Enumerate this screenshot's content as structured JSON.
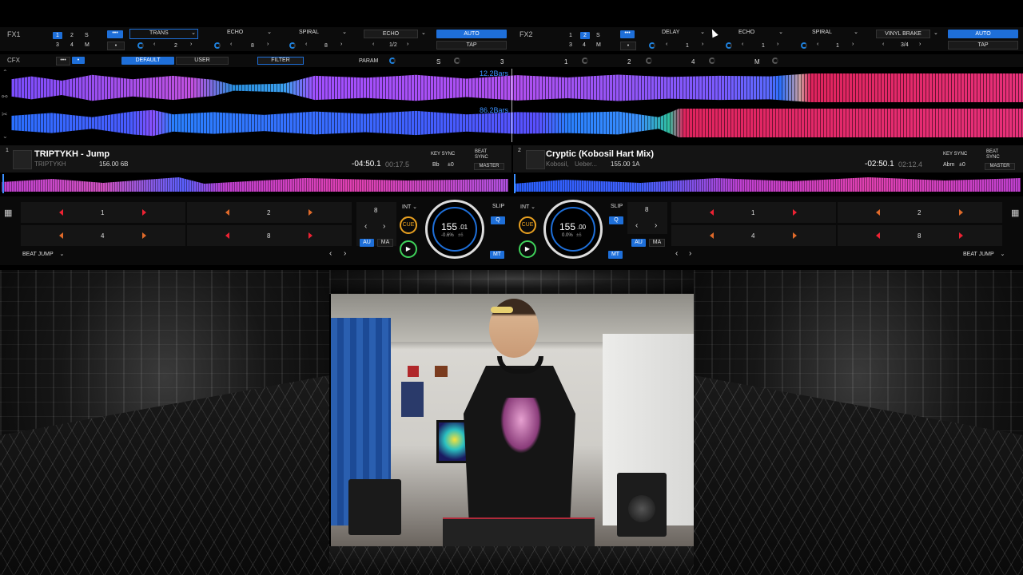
{
  "fx1": {
    "label": "FX1",
    "deck_grid": [
      "1",
      "2",
      "S",
      "3",
      "4",
      "M"
    ],
    "slots": [
      "TRANS",
      "ECHO",
      "SPIRAL"
    ],
    "slot_values": [
      "2",
      "8",
      "8"
    ],
    "effect": "ECHO",
    "effect_value": "1/2",
    "auto": "AUTO",
    "tap": "TAP"
  },
  "fx2": {
    "label": "FX2",
    "deck_grid": [
      "1",
      "2",
      "S",
      "3",
      "4",
      "M"
    ],
    "slots": [
      "DELAY",
      "ECHO",
      "SPIRAL"
    ],
    "slot_values": [
      "1",
      "1",
      "1"
    ],
    "effect": "VINYL BRAKE",
    "effect_value": "3/4",
    "auto": "AUTO",
    "tap": "TAP"
  },
  "cfx": {
    "label": "CFX",
    "default": "DEFAULT",
    "user": "USER",
    "filter": "FILTER",
    "param": "PARAM",
    "letters": [
      "S",
      "3",
      "1",
      "2",
      "4",
      "M"
    ]
  },
  "waveform": {
    "top_marker": "12.2Bars",
    "bottom_marker": "86.2Bars"
  },
  "deck1": {
    "num": "1",
    "title": "TRIPTYKH - Jump",
    "artist": "TRIPTYKH",
    "bpm_key": "156.00 6B",
    "remain": "-04:50.1",
    "elapsed": "00:17.5",
    "key_sync": "KEY SYNC",
    "key": "Bb",
    "key_offset": "±0",
    "beat_sync": "BEAT SYNC",
    "master": "MASTER",
    "pads": [
      "1",
      "2",
      "4",
      "8"
    ],
    "loop_size": "8",
    "int": "INT",
    "slip": "SLIP",
    "cue": "CUE",
    "q": "Q",
    "au": "AU",
    "ma": "MA",
    "mt": "MT",
    "bpm_main": "155",
    "bpm_dec": ".01",
    "pitch": "-0.6%",
    "pitch_range": "±6",
    "beat_jump": "BEAT JUMP"
  },
  "deck2": {
    "num": "2",
    "title": "Cryptic (Kobosil Hart Mix)",
    "artist": "Kobosil,",
    "artist2": "Ueber...",
    "bpm_key": "155.00 1A",
    "remain": "-02:50.1",
    "elapsed": "02:12.4",
    "key_sync": "KEY SYNC",
    "key": "Abm",
    "key_offset": "±0",
    "beat_sync": "BEAT SYNC",
    "master": "MASTER",
    "pads": [
      "1",
      "2",
      "4",
      "8"
    ],
    "loop_size": "8",
    "int": "INT",
    "slip": "SLIP",
    "cue": "CUE",
    "q": "Q",
    "au": "AU",
    "ma": "MA",
    "mt": "MT",
    "bpm_main": "155",
    "bpm_dec": ".00",
    "pitch": "0.0%",
    "pitch_range": "±6",
    "beat_jump": "BEAT JUMP"
  },
  "colors": {
    "accent": "#1e6fd9",
    "wave_pink": "#e0245e",
    "wave_purple": "#9b4dff",
    "wave_blue": "#2a7fff",
    "cue_orange": "#e8a020",
    "play_green": "#3fd25a"
  }
}
